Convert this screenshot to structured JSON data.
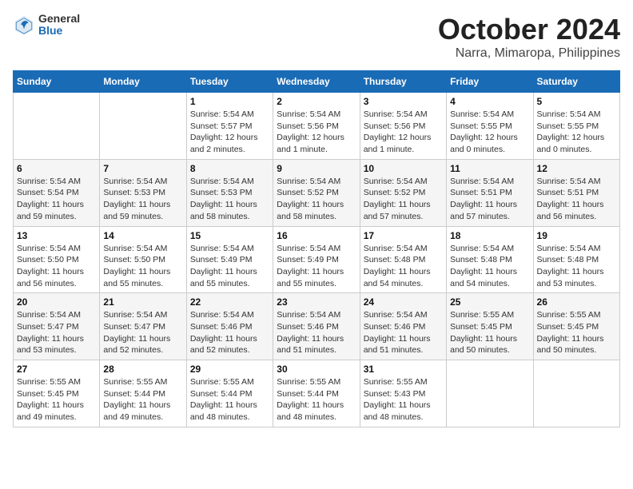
{
  "logo": {
    "general": "General",
    "blue": "Blue"
  },
  "title": {
    "month": "October 2024",
    "location": "Narra, Mimaropa, Philippines"
  },
  "weekdays": [
    "Sunday",
    "Monday",
    "Tuesday",
    "Wednesday",
    "Thursday",
    "Friday",
    "Saturday"
  ],
  "weeks": [
    [
      {
        "day": "",
        "sunrise": "",
        "sunset": "",
        "daylight": ""
      },
      {
        "day": "",
        "sunrise": "",
        "sunset": "",
        "daylight": ""
      },
      {
        "day": "1",
        "sunrise": "Sunrise: 5:54 AM",
        "sunset": "Sunset: 5:57 PM",
        "daylight": "Daylight: 12 hours and 2 minutes."
      },
      {
        "day": "2",
        "sunrise": "Sunrise: 5:54 AM",
        "sunset": "Sunset: 5:56 PM",
        "daylight": "Daylight: 12 hours and 1 minute."
      },
      {
        "day": "3",
        "sunrise": "Sunrise: 5:54 AM",
        "sunset": "Sunset: 5:56 PM",
        "daylight": "Daylight: 12 hours and 1 minute."
      },
      {
        "day": "4",
        "sunrise": "Sunrise: 5:54 AM",
        "sunset": "Sunset: 5:55 PM",
        "daylight": "Daylight: 12 hours and 0 minutes."
      },
      {
        "day": "5",
        "sunrise": "Sunrise: 5:54 AM",
        "sunset": "Sunset: 5:55 PM",
        "daylight": "Daylight: 12 hours and 0 minutes."
      }
    ],
    [
      {
        "day": "6",
        "sunrise": "Sunrise: 5:54 AM",
        "sunset": "Sunset: 5:54 PM",
        "daylight": "Daylight: 11 hours and 59 minutes."
      },
      {
        "day": "7",
        "sunrise": "Sunrise: 5:54 AM",
        "sunset": "Sunset: 5:53 PM",
        "daylight": "Daylight: 11 hours and 59 minutes."
      },
      {
        "day": "8",
        "sunrise": "Sunrise: 5:54 AM",
        "sunset": "Sunset: 5:53 PM",
        "daylight": "Daylight: 11 hours and 58 minutes."
      },
      {
        "day": "9",
        "sunrise": "Sunrise: 5:54 AM",
        "sunset": "Sunset: 5:52 PM",
        "daylight": "Daylight: 11 hours and 58 minutes."
      },
      {
        "day": "10",
        "sunrise": "Sunrise: 5:54 AM",
        "sunset": "Sunset: 5:52 PM",
        "daylight": "Daylight: 11 hours and 57 minutes."
      },
      {
        "day": "11",
        "sunrise": "Sunrise: 5:54 AM",
        "sunset": "Sunset: 5:51 PM",
        "daylight": "Daylight: 11 hours and 57 minutes."
      },
      {
        "day": "12",
        "sunrise": "Sunrise: 5:54 AM",
        "sunset": "Sunset: 5:51 PM",
        "daylight": "Daylight: 11 hours and 56 minutes."
      }
    ],
    [
      {
        "day": "13",
        "sunrise": "Sunrise: 5:54 AM",
        "sunset": "Sunset: 5:50 PM",
        "daylight": "Daylight: 11 hours and 56 minutes."
      },
      {
        "day": "14",
        "sunrise": "Sunrise: 5:54 AM",
        "sunset": "Sunset: 5:50 PM",
        "daylight": "Daylight: 11 hours and 55 minutes."
      },
      {
        "day": "15",
        "sunrise": "Sunrise: 5:54 AM",
        "sunset": "Sunset: 5:49 PM",
        "daylight": "Daylight: 11 hours and 55 minutes."
      },
      {
        "day": "16",
        "sunrise": "Sunrise: 5:54 AM",
        "sunset": "Sunset: 5:49 PM",
        "daylight": "Daylight: 11 hours and 55 minutes."
      },
      {
        "day": "17",
        "sunrise": "Sunrise: 5:54 AM",
        "sunset": "Sunset: 5:48 PM",
        "daylight": "Daylight: 11 hours and 54 minutes."
      },
      {
        "day": "18",
        "sunrise": "Sunrise: 5:54 AM",
        "sunset": "Sunset: 5:48 PM",
        "daylight": "Daylight: 11 hours and 54 minutes."
      },
      {
        "day": "19",
        "sunrise": "Sunrise: 5:54 AM",
        "sunset": "Sunset: 5:48 PM",
        "daylight": "Daylight: 11 hours and 53 minutes."
      }
    ],
    [
      {
        "day": "20",
        "sunrise": "Sunrise: 5:54 AM",
        "sunset": "Sunset: 5:47 PM",
        "daylight": "Daylight: 11 hours and 53 minutes."
      },
      {
        "day": "21",
        "sunrise": "Sunrise: 5:54 AM",
        "sunset": "Sunset: 5:47 PM",
        "daylight": "Daylight: 11 hours and 52 minutes."
      },
      {
        "day": "22",
        "sunrise": "Sunrise: 5:54 AM",
        "sunset": "Sunset: 5:46 PM",
        "daylight": "Daylight: 11 hours and 52 minutes."
      },
      {
        "day": "23",
        "sunrise": "Sunrise: 5:54 AM",
        "sunset": "Sunset: 5:46 PM",
        "daylight": "Daylight: 11 hours and 51 minutes."
      },
      {
        "day": "24",
        "sunrise": "Sunrise: 5:54 AM",
        "sunset": "Sunset: 5:46 PM",
        "daylight": "Daylight: 11 hours and 51 minutes."
      },
      {
        "day": "25",
        "sunrise": "Sunrise: 5:55 AM",
        "sunset": "Sunset: 5:45 PM",
        "daylight": "Daylight: 11 hours and 50 minutes."
      },
      {
        "day": "26",
        "sunrise": "Sunrise: 5:55 AM",
        "sunset": "Sunset: 5:45 PM",
        "daylight": "Daylight: 11 hours and 50 minutes."
      }
    ],
    [
      {
        "day": "27",
        "sunrise": "Sunrise: 5:55 AM",
        "sunset": "Sunset: 5:45 PM",
        "daylight": "Daylight: 11 hours and 49 minutes."
      },
      {
        "day": "28",
        "sunrise": "Sunrise: 5:55 AM",
        "sunset": "Sunset: 5:44 PM",
        "daylight": "Daylight: 11 hours and 49 minutes."
      },
      {
        "day": "29",
        "sunrise": "Sunrise: 5:55 AM",
        "sunset": "Sunset: 5:44 PM",
        "daylight": "Daylight: 11 hours and 48 minutes."
      },
      {
        "day": "30",
        "sunrise": "Sunrise: 5:55 AM",
        "sunset": "Sunset: 5:44 PM",
        "daylight": "Daylight: 11 hours and 48 minutes."
      },
      {
        "day": "31",
        "sunrise": "Sunrise: 5:55 AM",
        "sunset": "Sunset: 5:43 PM",
        "daylight": "Daylight: 11 hours and 48 minutes."
      },
      {
        "day": "",
        "sunrise": "",
        "sunset": "",
        "daylight": ""
      },
      {
        "day": "",
        "sunrise": "",
        "sunset": "",
        "daylight": ""
      }
    ]
  ]
}
